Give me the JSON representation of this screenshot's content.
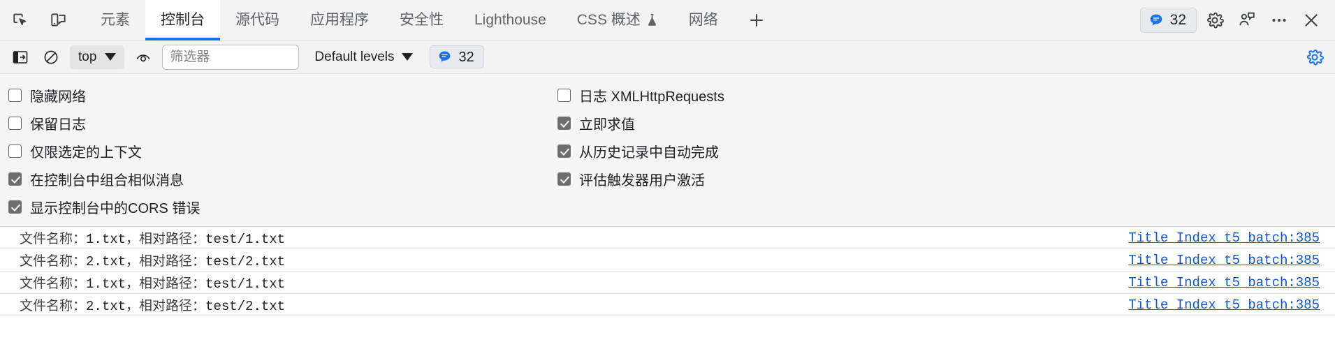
{
  "tabbar": {
    "left_icons": [
      {
        "name": "inspect-element-icon",
        "label": "Inspect element"
      },
      {
        "name": "device-toolbar-icon",
        "label": "Toggle device toolbar"
      }
    ],
    "tabs": [
      {
        "label": "元素",
        "active": false,
        "icon": null
      },
      {
        "label": "控制台",
        "active": true,
        "icon": null
      },
      {
        "label": "源代码",
        "active": false,
        "icon": null
      },
      {
        "label": "应用程序",
        "active": false,
        "icon": null
      },
      {
        "label": "安全性",
        "active": false,
        "icon": null
      },
      {
        "label": "Lighthouse",
        "active": false,
        "icon": null
      },
      {
        "label": "CSS 概述",
        "active": false,
        "icon": "experiment-flask-icon"
      },
      {
        "label": "网络",
        "active": false,
        "icon": null
      }
    ],
    "add_tab_label": "+",
    "message_count": "32",
    "right_icons": [
      {
        "name": "settings-gear-icon"
      },
      {
        "name": "feedback-icon"
      },
      {
        "name": "more-options-icon"
      },
      {
        "name": "close-devtools-icon"
      }
    ]
  },
  "toolbar": {
    "sidebar_toggle": "console-sidebar-icon",
    "clear_console": "clear-console-icon",
    "context_value": "top",
    "eye_icon": "live-expression-icon",
    "filter_placeholder": "筛选器",
    "filter_value": "",
    "levels_value": "Default levels",
    "message_count": "32",
    "settings_gear": "console-settings-icon",
    "accent_color": "#1a73e8"
  },
  "settings": {
    "left": [
      {
        "label": "隐藏网络",
        "checked": false
      },
      {
        "label": "保留日志",
        "checked": false
      },
      {
        "label": "仅限选定的上下文",
        "checked": false
      },
      {
        "label": "在控制台中组合相似消息",
        "checked": true
      },
      {
        "label": "显示控制台中的CORS 错误",
        "checked": true
      }
    ],
    "right": [
      {
        "label": "日志 XMLHttpRequests",
        "checked": false
      },
      {
        "label": "立即求值",
        "checked": true
      },
      {
        "label": "从历史记录中自动完成",
        "checked": true
      },
      {
        "label": "评估触发器用户激活",
        "checked": true
      }
    ]
  },
  "console": {
    "rows": [
      {
        "label_file": "文件名称：",
        "file": "1.txt",
        "label_path": "，相对路径：",
        "path": "test/1.txt",
        "source": "Title_Index_t5_batch:385"
      },
      {
        "label_file": "文件名称：",
        "file": "2.txt",
        "label_path": "，相对路径：",
        "path": "test/2.txt",
        "source": "Title_Index_t5_batch:385"
      },
      {
        "label_file": "文件名称：",
        "file": "1.txt",
        "label_path": "，相对路径：",
        "path": "test/1.txt",
        "source": "Title_Index_t5_batch:385"
      },
      {
        "label_file": "文件名称：",
        "file": "2.txt",
        "label_path": "，相对路径：",
        "path": "test/2.txt",
        "source": "Title_Index_t5_batch:385"
      }
    ],
    "link_color": "#1155cc"
  }
}
